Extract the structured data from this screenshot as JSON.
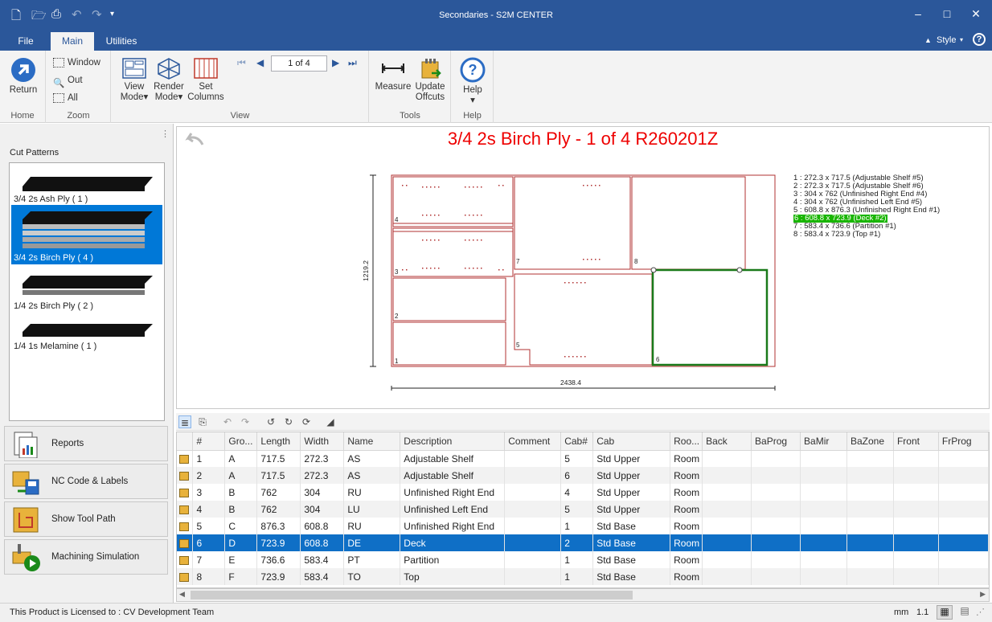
{
  "window": {
    "title": "Secondaries - S2M CENTER"
  },
  "ribbon_tabs": [
    {
      "label": "File"
    },
    {
      "label": "Main"
    },
    {
      "label": "Utilities"
    }
  ],
  "style_label": "Style",
  "ribbon": {
    "home": {
      "return_label": "Return",
      "group_label": "Home"
    },
    "zoom": {
      "window_label": "Window",
      "out_label": "Out",
      "all_label": "All",
      "group_label": "Zoom"
    },
    "view": {
      "page": "1 of 4",
      "view_mode_1": "View",
      "view_mode_2": "Mode",
      "render_mode_1": "Render",
      "render_mode_2": "Mode",
      "set_columns_1": "Set",
      "set_columns_2": "Columns",
      "group_label": "View"
    },
    "tools": {
      "measure_label": "Measure",
      "update_1": "Update",
      "update_2": "Offcuts",
      "group_label": "Tools"
    },
    "help": {
      "help_label": "Help",
      "group_label": "Help"
    }
  },
  "left_panel": {
    "title": "Cut Patterns",
    "patterns": [
      {
        "label": "3/4 2s Ash Ply  ( 1 )",
        "sheets": 1
      },
      {
        "label": "3/4 2s Birch Ply  ( 4 )",
        "sheets": 4
      },
      {
        "label": "1/4 2s Birch Ply  ( 2 )",
        "sheets": 2
      },
      {
        "label": "1/4 1s Melamine  ( 1 )",
        "sheets": 1
      }
    ],
    "buttons": [
      {
        "label": "Reports"
      },
      {
        "label": "NC Code & Labels"
      },
      {
        "label": "Show Tool Path"
      },
      {
        "label": "Machining Simulation"
      }
    ]
  },
  "canvas": {
    "title": "3/4 2s Birch Ply - 1 of 4 R260201Z",
    "sheet_height_dim": "1219.2",
    "sheet_width_dim": "2438.4",
    "part_numbers": [
      "1",
      "2",
      "3",
      "4",
      "5",
      "6",
      "7",
      "8"
    ],
    "legend": [
      {
        "text": "1 : 272.3 x 717.5 (Adjustable Shelf #5)",
        "highlighted": false
      },
      {
        "text": "2 : 272.3 x 717.5 (Adjustable Shelf #6)",
        "highlighted": false
      },
      {
        "text": "3 : 304 x 762 (Unfinished Right End #4)",
        "highlighted": false
      },
      {
        "text": "4 : 304 x 762 (Unfinished Left End #5)",
        "highlighted": false
      },
      {
        "text": "5 : 608.8 x 876.3 (Unfinished Right End #1)",
        "highlighted": false
      },
      {
        "text": "6 : 608.8 x 723.9 (Deck #2)",
        "highlighted": true
      },
      {
        "text": "7 : 583.4 x 736.6 (Partition #1)",
        "highlighted": false
      },
      {
        "text": "8 : 583.4 x 723.9 (Top #1)",
        "highlighted": false
      }
    ],
    "colors": {
      "part_outline": "#b03030",
      "selected": "#1a7a1a",
      "highlight": "#18b500"
    }
  },
  "grid": {
    "columns": [
      "#",
      "Gro...",
      "Length",
      "Width",
      "Name",
      "Description",
      "Comment",
      "Cab#",
      "Cab",
      "Roo...",
      "Back",
      "BaProg",
      "BaMir",
      "BaZone",
      "Front",
      "FrProg"
    ],
    "rows": [
      [
        "1",
        "A",
        "717.5",
        "272.3",
        "AS",
        "Adjustable Shelf",
        "",
        "5",
        "Std Upper",
        "Room",
        "",
        "",
        "",
        "",
        "",
        ""
      ],
      [
        "2",
        "A",
        "717.5",
        "272.3",
        "AS",
        "Adjustable Shelf",
        "",
        "6",
        "Std Upper",
        "Room",
        "",
        "",
        "",
        "",
        "",
        ""
      ],
      [
        "3",
        "B",
        "762",
        "304",
        "RU",
        "Unfinished Right End",
        "",
        "4",
        "Std Upper",
        "Room",
        "",
        "",
        "",
        "",
        "",
        ""
      ],
      [
        "4",
        "B",
        "762",
        "304",
        "LU",
        "Unfinished Left End",
        "",
        "5",
        "Std Upper",
        "Room",
        "",
        "",
        "",
        "",
        "",
        ""
      ],
      [
        "5",
        "C",
        "876.3",
        "608.8",
        "RU",
        "Unfinished Right End",
        "",
        "1",
        "Std Base",
        "Room",
        "",
        "",
        "",
        "",
        "",
        ""
      ],
      [
        "6",
        "D",
        "723.9",
        "608.8",
        "DE",
        "Deck",
        "",
        "2",
        "Std Base",
        "Room",
        "",
        "",
        "",
        "",
        "",
        ""
      ],
      [
        "7",
        "E",
        "736.6",
        "583.4",
        "PT",
        "Partition",
        "",
        "1",
        "Std Base",
        "Room",
        "",
        "",
        "",
        "",
        "",
        ""
      ],
      [
        "8",
        "F",
        "723.9",
        "583.4",
        "TO",
        "Top",
        "",
        "1",
        "Std Base",
        "Room",
        "",
        "",
        "",
        "",
        "",
        ""
      ]
    ],
    "selected_row": 5
  },
  "status": {
    "license": "This Product is Licensed to : CV Development Team",
    "units": "mm",
    "zoom": "1.1"
  }
}
